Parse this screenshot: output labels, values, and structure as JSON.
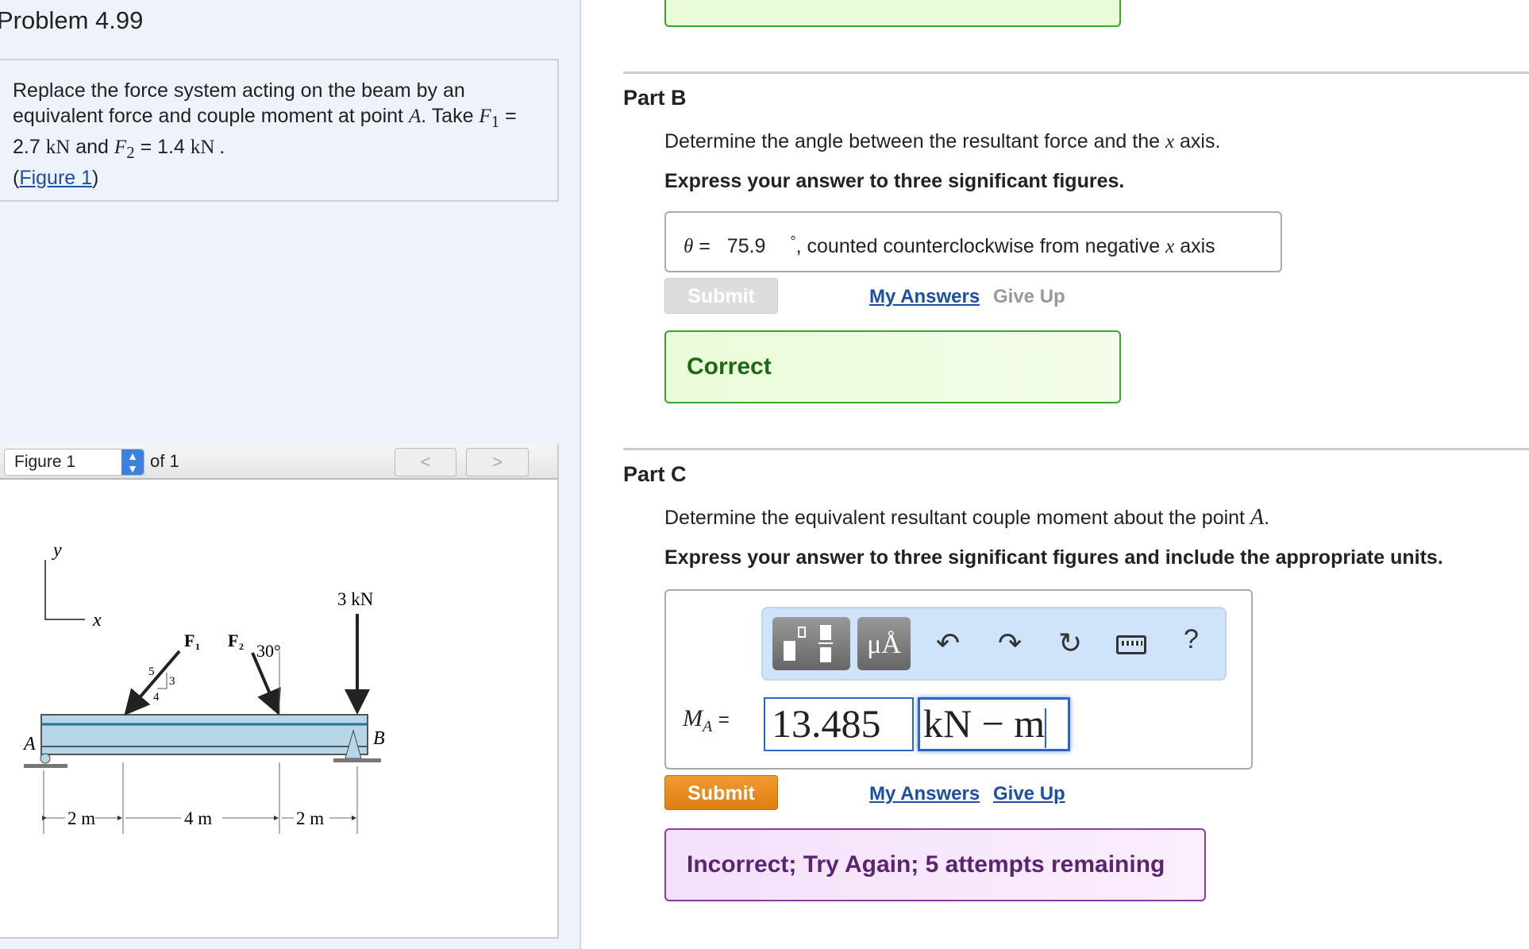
{
  "problem": {
    "title": "Problem 4.99",
    "statement_prefix": "Replace the force system acting on the beam by an equivalent force and couple moment at point",
    "point": "A",
    "take": ". Take",
    "f1_sym": "F",
    "f1_sub": "1",
    "f1_val": "= 2.7",
    "f1_unit": "kN",
    "and": "and",
    "f2_sym": "F",
    "f2_sub": "2",
    "f2_val": "= 1.4",
    "f2_unit": "kN .",
    "figure_link": "Figure 1"
  },
  "figure": {
    "select_value": "Figure 1",
    "of_label": "of 1",
    "prev": "<",
    "next": ">",
    "labels": {
      "y": "y",
      "x": "x",
      "f1": "F",
      "f1_sub": "1",
      "f2": "F",
      "f2_sub": "2",
      "angle": "30°",
      "load": "3 kN",
      "slope_5": "5",
      "slope_3": "3",
      "slope_4": "4",
      "point_a": "A",
      "point_b": "B",
      "dim1": "2 m",
      "dim2": "4 m",
      "dim3": "2 m"
    }
  },
  "partB": {
    "title": "Part B",
    "question": "Determine the angle between the resultant force and the",
    "axis_var": "x",
    "axis_word": "axis.",
    "instruction": "Express your answer to three significant figures.",
    "var": "θ",
    "eq": "=",
    "value": "75.9",
    "unit": "°",
    "suffix_pre": ", counted counterclockwise from negative",
    "suffix_var": "x",
    "suffix_post": "axis",
    "submit": "Submit",
    "my_answers": "My Answers",
    "give_up": "Give Up",
    "feedback": "Correct"
  },
  "partC": {
    "title": "Part C",
    "question": "Determine the equivalent resultant couple moment about the point",
    "point": "A",
    "instruction": "Express your answer to three significant figures and include the appropriate units.",
    "var": "M",
    "var_sub": "A",
    "eq": "=",
    "value": "13.485",
    "units": "kN − m",
    "help": "?",
    "submit": "Submit",
    "my_answers": "My Answers",
    "give_up": "Give Up",
    "feedback": "Incorrect; Try Again; 5 attempts remaining"
  },
  "colors": {
    "correct_bg": "#eafbd9",
    "correct_border": "#3aa52a",
    "correct_text": "#1c6b12",
    "incorrect_bg": "#f6e4fb",
    "incorrect_border": "#8a3aa0",
    "incorrect_text": "#5a2470",
    "submit_orange": "#e8891c",
    "link": "#1a4fa3"
  }
}
